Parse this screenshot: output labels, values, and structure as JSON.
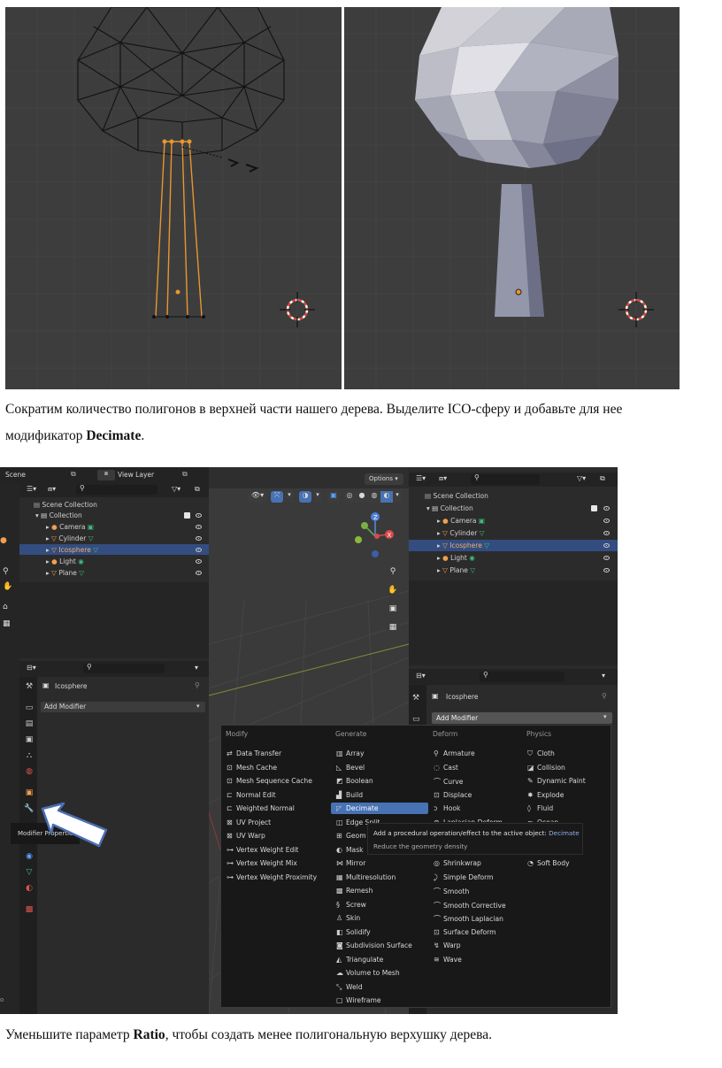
{
  "paragraph1": {
    "line1": "Сократим количество полигонов в верхней части нашего дерева. Выделите ICO-сферу и добавьте для нее",
    "line2_prefix": "модификатор ",
    "line2_bold": "Decimate",
    "line2_suffix": "."
  },
  "paragraph2": {
    "prefix": "Уменьшите параметр ",
    "bold": "Ratio",
    "suffix": ", чтобы создать менее полигональную верхушку дерева."
  },
  "ui": {
    "left_panel": {
      "scene_label": "Scene",
      "view_layer_label": "View Layer",
      "outliner": {
        "root": "Scene Collection",
        "collection": "Collection",
        "items": [
          "Camera",
          "Cylinder",
          "Icosphere",
          "Light",
          "Plane"
        ],
        "selected": "Icosphere"
      },
      "properties": {
        "object_name": "Icosphere",
        "add_modifier": "Add Modifier",
        "tooltip": "Modifier Properties"
      }
    },
    "viewport": {
      "options_label": "Options"
    },
    "right_panel": {
      "outliner": {
        "root": "Scene Collection",
        "collection": "Collection",
        "items": [
          "Camera",
          "Cylinder",
          "Icosphere",
          "Light",
          "Plane"
        ],
        "selected": "Icosphere"
      },
      "properties": {
        "object_name": "Icosphere",
        "add_modifier": "Add Modifier"
      }
    },
    "add_modifier_menu": {
      "headers": [
        "Modify",
        "Generate",
        "Deform",
        "Physics"
      ],
      "modify": [
        "Data Transfer",
        "Mesh Cache",
        "Mesh Sequence Cache",
        "Normal Edit",
        "Weighted Normal",
        "UV Project",
        "UV Warp",
        "Vertex Weight Edit",
        "Vertex Weight Mix",
        "Vertex Weight Proximity"
      ],
      "generate": [
        "Array",
        "Bevel",
        "Boolean",
        "Build",
        "Decimate",
        "Edge Split",
        "Geom",
        "Mask",
        "Mirror",
        "Multiresolution",
        "Remesh",
        "Screw",
        "Skin",
        "Solidify",
        "Subdivision Surface",
        "Triangulate",
        "Volume to Mesh",
        "Weld",
        "Wireframe"
      ],
      "deform": [
        "Armature",
        "Cast",
        "Curve",
        "Displace",
        "Hook",
        "Laplacian Deform",
        "Shrinkwrap",
        "Simple Deform",
        "Smooth",
        "Smooth Corrective",
        "Smooth Laplacian",
        "Surface Deform",
        "Warp",
        "Wave"
      ],
      "physics": [
        "Cloth",
        "Collision",
        "Dynamic Paint",
        "Explode",
        "Fluid",
        "Ocean",
        "Soft Body"
      ],
      "highlighted": "Decimate",
      "tooltip_title": "Add a procedural operation/effect to the active object:",
      "tooltip_title_value": "Decimate",
      "tooltip_desc": "Reduce the geometry density"
    }
  },
  "colors": {
    "viewport_bg": "#3d3d3d",
    "selection": "#334d80",
    "highlight": "#4772b3",
    "wire_selected": "#e8962f"
  }
}
